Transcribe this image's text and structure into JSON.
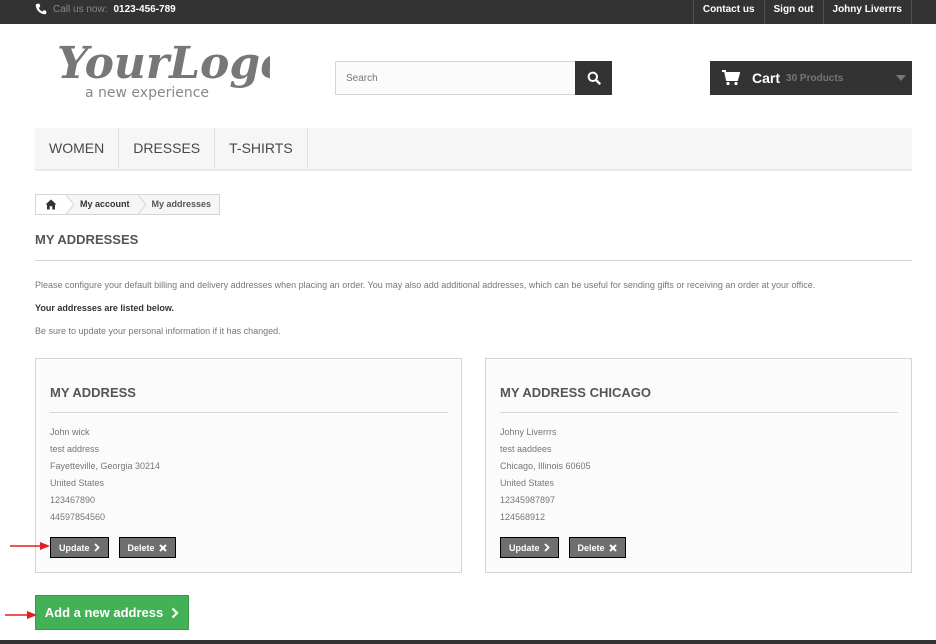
{
  "topbar": {
    "call_prefix": "Call us now:",
    "phone": "0123-456-789",
    "links": [
      "Contact us",
      "Sign out",
      "Johny Liverrrs"
    ]
  },
  "logo": {
    "main": "YourLogo",
    "tagline": "a new experience"
  },
  "search": {
    "placeholder": "Search"
  },
  "cart": {
    "label": "Cart",
    "count": "30 Products"
  },
  "menu": [
    "WOMEN",
    "DRESSES",
    "T-SHIRTS"
  ],
  "breadcrumb": [
    "My account",
    "My addresses"
  ],
  "page": {
    "title": "MY ADDRESSES",
    "intro": "Please configure your default billing and delivery addresses when placing an order. You may also add additional addresses, which can be useful for sending gifts or receiving an order at your office.",
    "listed": "Your addresses are listed below.",
    "update_note": "Be sure to update your personal information if it has changed."
  },
  "addresses": [
    {
      "title": "MY ADDRESS",
      "lines": [
        "John wick",
        "test address",
        "Fayetteville, Georgia 30214",
        "United States",
        "123467890",
        "44597854560"
      ]
    },
    {
      "title": "MY ADDRESS CHICAGO",
      "lines": [
        "Johny Liverrrs",
        "test aaddees",
        "Chicago, Illinois 60605",
        "United States",
        "12345987897",
        "124568912"
      ]
    }
  ],
  "buttons": {
    "update": "Update",
    "delete": "Delete",
    "add": "Add a new address"
  },
  "colors": {
    "dark": "#333333",
    "green": "#43b155",
    "arrow": "#e02020"
  }
}
